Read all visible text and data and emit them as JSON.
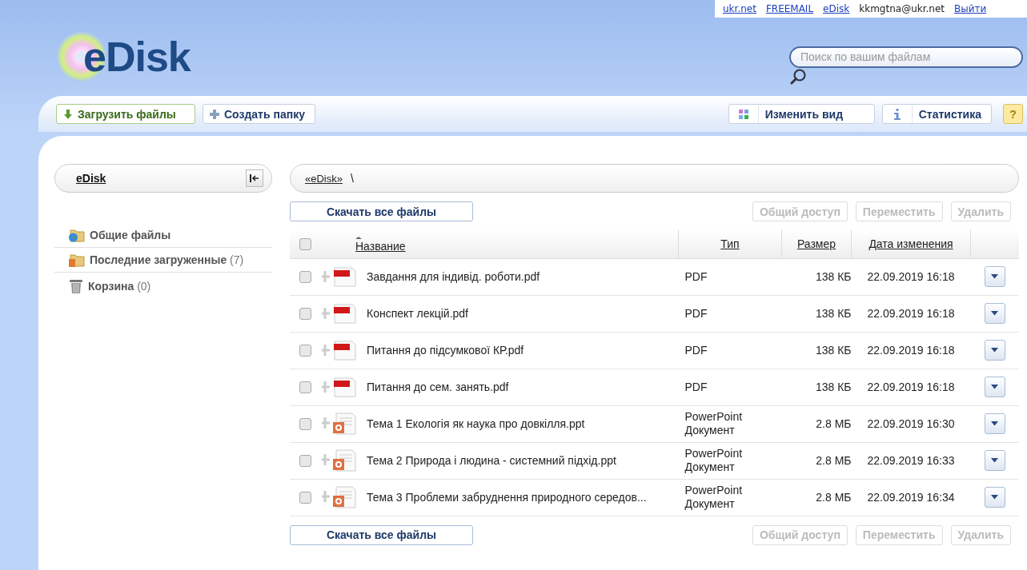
{
  "top_bar": [
    {
      "text": "ukr.net",
      "kind": "link"
    },
    {
      "text": "FREEMAIL",
      "kind": "link"
    },
    {
      "text": "eDisk",
      "kind": "link"
    },
    {
      "text": "kkmgtna@ukr.net",
      "kind": "text"
    },
    {
      "text": "Выйти",
      "kind": "link"
    }
  ],
  "logo": {
    "text": "eDisk"
  },
  "search": {
    "placeholder": "Поиск по вашим файлам"
  },
  "toolbar": {
    "left": [
      {
        "label": "Загрузить файлы",
        "kind": "upload"
      },
      {
        "label": "Создать папку",
        "kind": "folder"
      }
    ],
    "right": [
      {
        "label": "Изменить вид",
        "kind": "view"
      },
      {
        "label": "Статистика",
        "kind": "stats"
      }
    ],
    "help": "?"
  },
  "sidebar": {
    "title": "eDisk",
    "items": [
      {
        "label": "Общие файлы",
        "kind": "shared"
      },
      {
        "label": "Последние загруженные",
        "count": "(7)",
        "kind": "recent"
      },
      {
        "label": "Корзина",
        "count": "(0)",
        "kind": "trash"
      }
    ]
  },
  "breadcrumb": {
    "link": "«eDisk»",
    "separator": "\\"
  },
  "actions": {
    "download_all": "Скачать все файлы",
    "buttons": [
      {
        "label": "Общий доступ",
        "disabled": true
      },
      {
        "label": "Переместить",
        "disabled": true
      },
      {
        "label": "Удалить",
        "disabled": true
      }
    ]
  },
  "table": {
    "columns": [
      "Название",
      "Тип",
      "Размер",
      "Дата изменения"
    ],
    "all_checked": false,
    "rows": [
      {
        "name": "Завдання для індивід. роботи.pdf",
        "kind": "pdf",
        "type": "PDF",
        "size": "138 КБ",
        "date": "22.09.2019 16:18",
        "checked": false
      },
      {
        "name": "Конспект лекцій.pdf",
        "kind": "pdf",
        "type": "PDF",
        "size": "138 КБ",
        "date": "22.09.2019 16:18",
        "checked": false
      },
      {
        "name": "Питання до підсумкової КР.pdf",
        "kind": "pdf",
        "type": "PDF",
        "size": "138 КБ",
        "date": "22.09.2019 16:18",
        "checked": false
      },
      {
        "name": "Питання до сем. занять.pdf",
        "kind": "pdf",
        "type": "PDF",
        "size": "138 КБ",
        "date": "22.09.2019 16:18",
        "checked": false
      },
      {
        "name": "Тема 1 Екологія як наука про довкілля.ppt",
        "kind": "ppt",
        "type": "PowerPoint Документ",
        "size": "2.8 МБ",
        "date": "22.09.2019 16:30",
        "checked": false
      },
      {
        "name": "Тема 2 Природа і людина - системний підхід.ppt",
        "kind": "ppt",
        "type": "PowerPoint Документ",
        "size": "2.8 МБ",
        "date": "22.09.2019 16:33",
        "checked": false
      },
      {
        "name": "Тема 3 Проблеми забруднення природного середов...",
        "kind": "ppt",
        "type": "PowerPoint Документ",
        "size": "2.8 МБ",
        "date": "22.09.2019 16:34",
        "checked": false
      }
    ]
  },
  "bottom_actions": {
    "download_all": "Скачать все файлы",
    "buttons": [
      {
        "label": "Общий доступ",
        "disabled": true
      },
      {
        "label": "Переместить",
        "disabled": true
      },
      {
        "label": "Удалить",
        "disabled": true
      }
    ]
  }
}
